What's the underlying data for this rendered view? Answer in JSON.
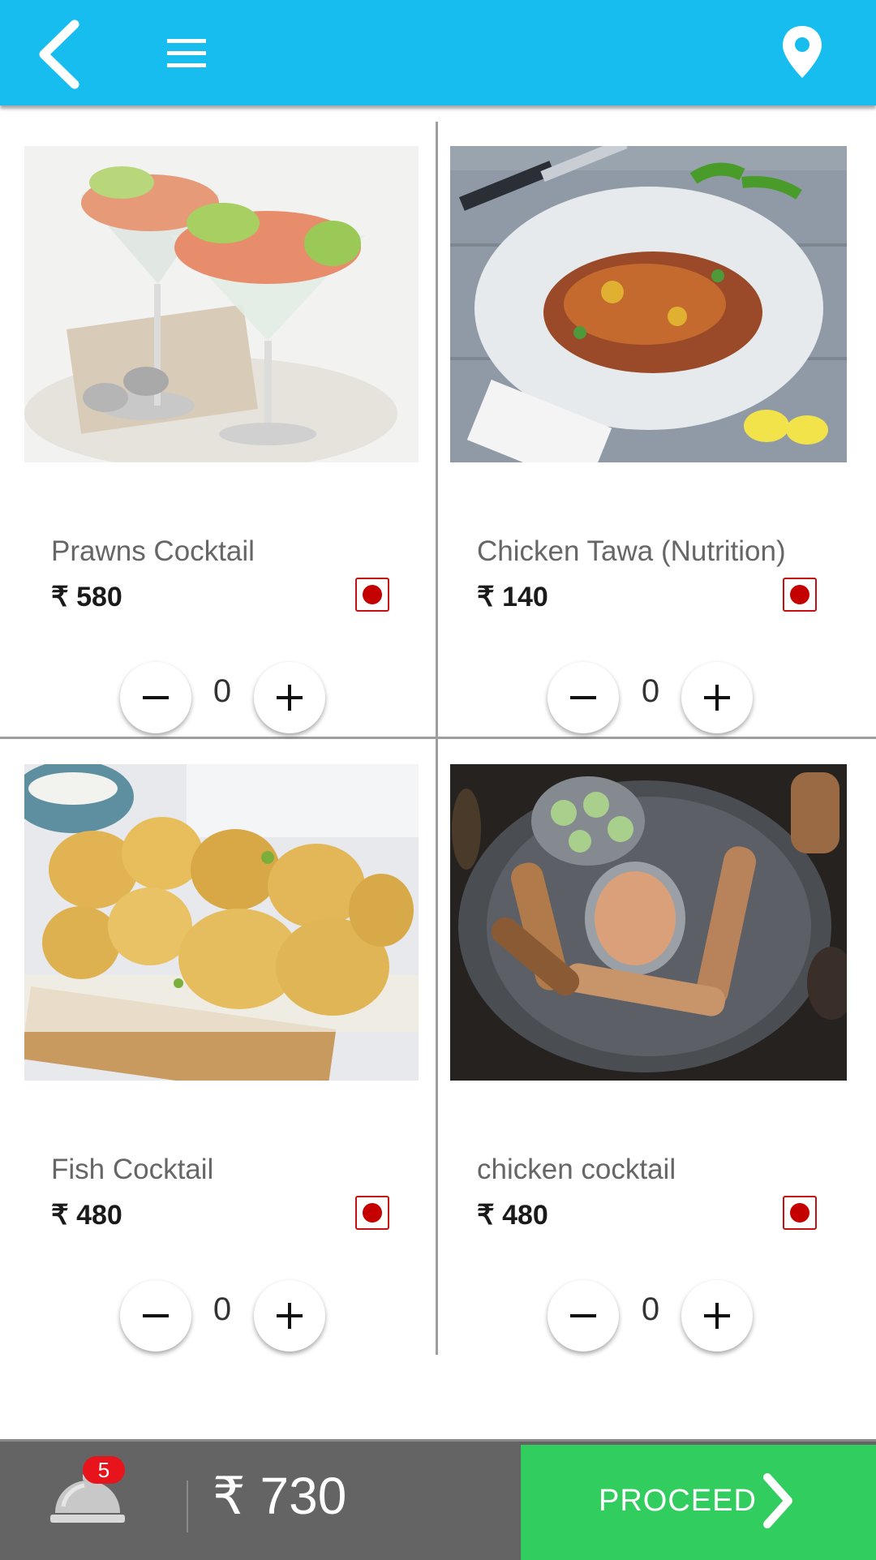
{
  "header": {
    "back_icon": "chevron-left-icon",
    "menu_icon": "hamburger-menu-icon",
    "location_icon": "map-pin-icon",
    "background": "#18bdf0"
  },
  "items": [
    {
      "name": "Prawns Cocktail",
      "price": "₹ 580",
      "qty": "0",
      "image": "prawns-cocktail-image",
      "diet_mark": "non-veg-icon"
    },
    {
      "name": "Chicken Tawa (Nutrition)",
      "price": "₹ 140",
      "qty": "0",
      "image": "chicken-tawa-image",
      "diet_mark": "non-veg-icon"
    },
    {
      "name": "Fish Cocktail",
      "price": "₹ 480",
      "qty": "0",
      "image": "fish-cocktail-image",
      "diet_mark": "non-veg-icon"
    },
    {
      "name": "chicken cocktail",
      "price": "₹ 480",
      "qty": "0",
      "image": "chicken-cocktail-image",
      "diet_mark": "non-veg-icon"
    }
  ],
  "footer": {
    "cart_count": "5",
    "total": "₹ 730",
    "proceed_label": "PROCEED",
    "proceed_color": "#32cd5f"
  }
}
